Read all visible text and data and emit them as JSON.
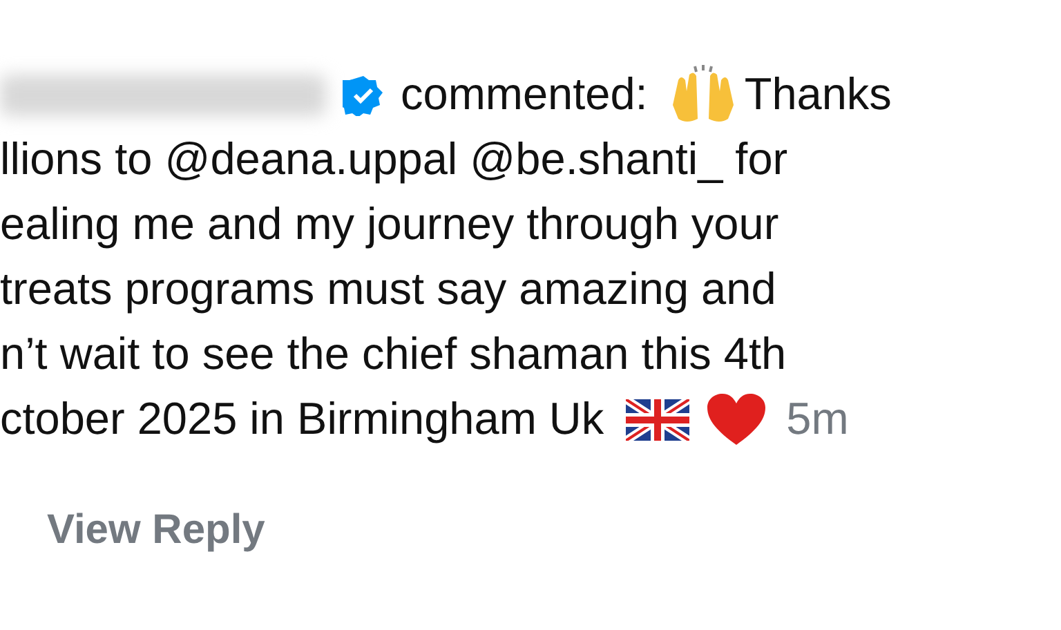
{
  "comment": {
    "verified": true,
    "verb": "commented:",
    "first_line_end": "Thanks",
    "lines": [
      "llions to @deana.uppal @be.shanti_ for",
      "ealing me and my journey through your",
      "treats programs must say amazing and",
      "n’t wait to see the chief shaman this 4th"
    ],
    "last_line": "ctober 2025 in Birmingham Uk",
    "time": "5m"
  },
  "view_reply": "View Reply"
}
